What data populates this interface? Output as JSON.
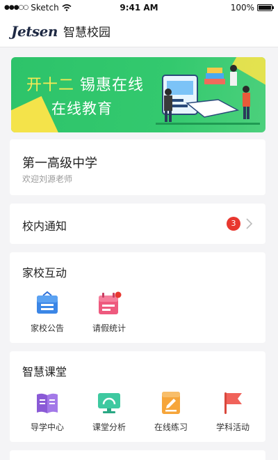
{
  "status_bar": {
    "carrier": "Sketch",
    "time": "9:41 AM",
    "battery": "100%"
  },
  "header": {
    "logo": "Jetsen",
    "title": "智慧校园"
  },
  "banner": {
    "line1_highlight": "开十二",
    "line1_rest": " 锡惠在线",
    "line2": "在线教育"
  },
  "school": {
    "name": "第一高级中学",
    "welcome": "欢迎刘源老师"
  },
  "notice": {
    "label": "校内通知",
    "count": "3"
  },
  "home_school": {
    "title": "家校互动",
    "items": [
      {
        "label": "家校公告",
        "icon": "announcement-icon"
      },
      {
        "label": "请假统计",
        "icon": "calendar-icon"
      }
    ]
  },
  "smart_class": {
    "title": "智慧课堂",
    "items": [
      {
        "label": "导学中心",
        "icon": "book-icon"
      },
      {
        "label": "课堂分析",
        "icon": "monitor-icon"
      },
      {
        "label": "在线练习",
        "icon": "exercise-icon"
      },
      {
        "label": "学科活动",
        "icon": "flag-icon"
      }
    ]
  },
  "colors": {
    "accent_green": "#2dc36a",
    "badge_red": "#e8372f",
    "highlight_yellow": "#f8ea55"
  }
}
